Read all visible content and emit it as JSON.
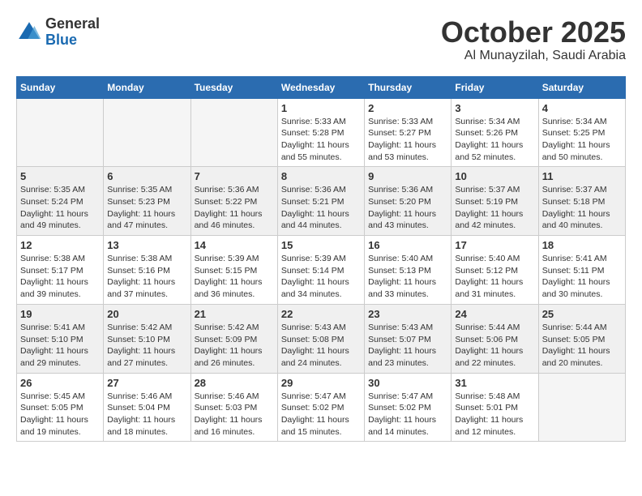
{
  "header": {
    "logo_line1": "General",
    "logo_line2": "Blue",
    "month": "October 2025",
    "location": "Al Munayzilah, Saudi Arabia"
  },
  "weekdays": [
    "Sunday",
    "Monday",
    "Tuesday",
    "Wednesday",
    "Thursday",
    "Friday",
    "Saturday"
  ],
  "weeks": [
    [
      {
        "day": "",
        "info": ""
      },
      {
        "day": "",
        "info": ""
      },
      {
        "day": "",
        "info": ""
      },
      {
        "day": "1",
        "info": "Sunrise: 5:33 AM\nSunset: 5:28 PM\nDaylight: 11 hours and 55 minutes."
      },
      {
        "day": "2",
        "info": "Sunrise: 5:33 AM\nSunset: 5:27 PM\nDaylight: 11 hours and 53 minutes."
      },
      {
        "day": "3",
        "info": "Sunrise: 5:34 AM\nSunset: 5:26 PM\nDaylight: 11 hours and 52 minutes."
      },
      {
        "day": "4",
        "info": "Sunrise: 5:34 AM\nSunset: 5:25 PM\nDaylight: 11 hours and 50 minutes."
      }
    ],
    [
      {
        "day": "5",
        "info": "Sunrise: 5:35 AM\nSunset: 5:24 PM\nDaylight: 11 hours and 49 minutes."
      },
      {
        "day": "6",
        "info": "Sunrise: 5:35 AM\nSunset: 5:23 PM\nDaylight: 11 hours and 47 minutes."
      },
      {
        "day": "7",
        "info": "Sunrise: 5:36 AM\nSunset: 5:22 PM\nDaylight: 11 hours and 46 minutes."
      },
      {
        "day": "8",
        "info": "Sunrise: 5:36 AM\nSunset: 5:21 PM\nDaylight: 11 hours and 44 minutes."
      },
      {
        "day": "9",
        "info": "Sunrise: 5:36 AM\nSunset: 5:20 PM\nDaylight: 11 hours and 43 minutes."
      },
      {
        "day": "10",
        "info": "Sunrise: 5:37 AM\nSunset: 5:19 PM\nDaylight: 11 hours and 42 minutes."
      },
      {
        "day": "11",
        "info": "Sunrise: 5:37 AM\nSunset: 5:18 PM\nDaylight: 11 hours and 40 minutes."
      }
    ],
    [
      {
        "day": "12",
        "info": "Sunrise: 5:38 AM\nSunset: 5:17 PM\nDaylight: 11 hours and 39 minutes."
      },
      {
        "day": "13",
        "info": "Sunrise: 5:38 AM\nSunset: 5:16 PM\nDaylight: 11 hours and 37 minutes."
      },
      {
        "day": "14",
        "info": "Sunrise: 5:39 AM\nSunset: 5:15 PM\nDaylight: 11 hours and 36 minutes."
      },
      {
        "day": "15",
        "info": "Sunrise: 5:39 AM\nSunset: 5:14 PM\nDaylight: 11 hours and 34 minutes."
      },
      {
        "day": "16",
        "info": "Sunrise: 5:40 AM\nSunset: 5:13 PM\nDaylight: 11 hours and 33 minutes."
      },
      {
        "day": "17",
        "info": "Sunrise: 5:40 AM\nSunset: 5:12 PM\nDaylight: 11 hours and 31 minutes."
      },
      {
        "day": "18",
        "info": "Sunrise: 5:41 AM\nSunset: 5:11 PM\nDaylight: 11 hours and 30 minutes."
      }
    ],
    [
      {
        "day": "19",
        "info": "Sunrise: 5:41 AM\nSunset: 5:10 PM\nDaylight: 11 hours and 29 minutes."
      },
      {
        "day": "20",
        "info": "Sunrise: 5:42 AM\nSunset: 5:10 PM\nDaylight: 11 hours and 27 minutes."
      },
      {
        "day": "21",
        "info": "Sunrise: 5:42 AM\nSunset: 5:09 PM\nDaylight: 11 hours and 26 minutes."
      },
      {
        "day": "22",
        "info": "Sunrise: 5:43 AM\nSunset: 5:08 PM\nDaylight: 11 hours and 24 minutes."
      },
      {
        "day": "23",
        "info": "Sunrise: 5:43 AM\nSunset: 5:07 PM\nDaylight: 11 hours and 23 minutes."
      },
      {
        "day": "24",
        "info": "Sunrise: 5:44 AM\nSunset: 5:06 PM\nDaylight: 11 hours and 22 minutes."
      },
      {
        "day": "25",
        "info": "Sunrise: 5:44 AM\nSunset: 5:05 PM\nDaylight: 11 hours and 20 minutes."
      }
    ],
    [
      {
        "day": "26",
        "info": "Sunrise: 5:45 AM\nSunset: 5:05 PM\nDaylight: 11 hours and 19 minutes."
      },
      {
        "day": "27",
        "info": "Sunrise: 5:46 AM\nSunset: 5:04 PM\nDaylight: 11 hours and 18 minutes."
      },
      {
        "day": "28",
        "info": "Sunrise: 5:46 AM\nSunset: 5:03 PM\nDaylight: 11 hours and 16 minutes."
      },
      {
        "day": "29",
        "info": "Sunrise: 5:47 AM\nSunset: 5:02 PM\nDaylight: 11 hours and 15 minutes."
      },
      {
        "day": "30",
        "info": "Sunrise: 5:47 AM\nSunset: 5:02 PM\nDaylight: 11 hours and 14 minutes."
      },
      {
        "day": "31",
        "info": "Sunrise: 5:48 AM\nSunset: 5:01 PM\nDaylight: 11 hours and 12 minutes."
      },
      {
        "day": "",
        "info": ""
      }
    ]
  ]
}
